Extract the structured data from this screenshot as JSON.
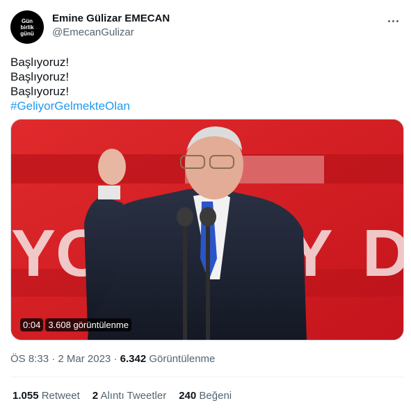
{
  "author": {
    "avatar_text": [
      "Gün",
      "birlik",
      "günü"
    ],
    "display_name": "Emine Gülizar EMECAN",
    "handle": "@EmecanGulizar"
  },
  "tweet": {
    "lines": [
      "Başlıyoruz!",
      "Başlıyoruz!",
      "Başlıyoruz!"
    ],
    "hashtag": "#GeliyorGelmekteOlan"
  },
  "video": {
    "duration": "0:04",
    "views": "3.608 görüntülenme",
    "backdrop_letters": "YOR  TY  D"
  },
  "meta": {
    "time": "ÖS 8:33",
    "separator": "·",
    "date": "2 Mar 2023",
    "views_count": "6.342",
    "views_label": "Görüntülenme"
  },
  "stats": {
    "retweets_count": "1.055",
    "retweets_label": "Retweet",
    "quotes_count": "2",
    "quotes_label": "Alıntı Tweetler",
    "likes_count": "240",
    "likes_label": "Beğeni"
  },
  "colors": {
    "accent": "#1d9bf0",
    "muted": "#536471",
    "stage_red": "#d41e24"
  },
  "icons": {
    "more": "more-horizontal-icon"
  }
}
